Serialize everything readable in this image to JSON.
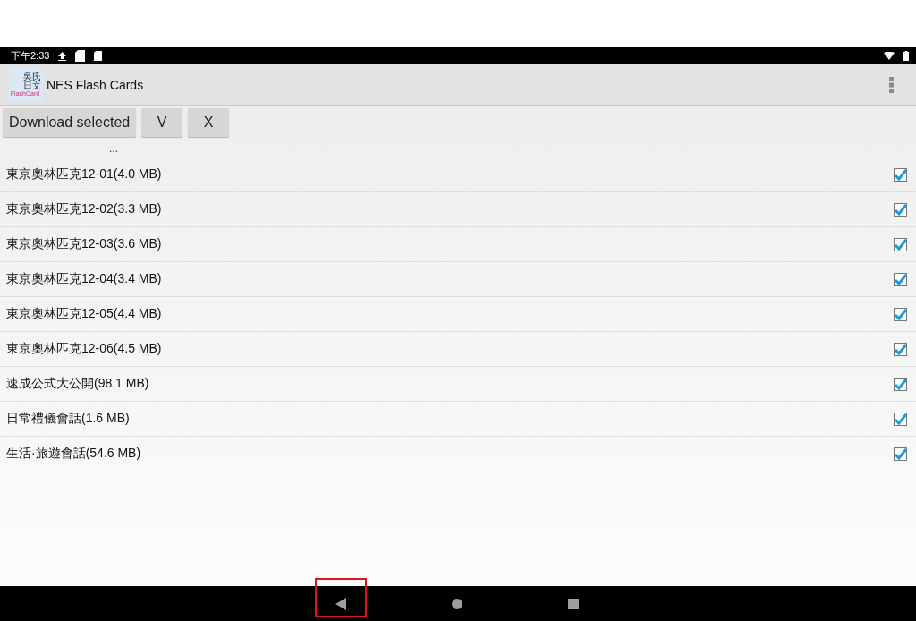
{
  "status_bar": {
    "time": "下午2:33"
  },
  "app_bar": {
    "icon_lines": [
      "吳氏",
      "日文"
    ],
    "icon_caption": "FlashCard",
    "title": "NES Flash Cards"
  },
  "toolbar": {
    "buttons": [
      "Download selected",
      "V",
      "X"
    ]
  },
  "parent_entry": "...",
  "files": [
    {
      "label": "東京奧林匹克12-01(4.0 MB)",
      "checked": true
    },
    {
      "label": "東京奧林匹克12-02(3.3 MB)",
      "checked": true
    },
    {
      "label": "東京奧林匹克12-03(3.6 MB)",
      "checked": true
    },
    {
      "label": "東京奧林匹克12-04(3.4 MB)",
      "checked": true
    },
    {
      "label": "東京奧林匹克12-05(4.4 MB)",
      "checked": true
    },
    {
      "label": "東京奧林匹克12-06(4.5 MB)",
      "checked": true
    },
    {
      "label": "速成公式大公開(98.1 MB)",
      "checked": true
    },
    {
      "label": "日常禮儀會話(1.6 MB)",
      "checked": true
    },
    {
      "label": "生活·旅遊會話(54.6 MB)",
      "checked": true
    }
  ],
  "nav_bar": [
    {
      "kind": "back",
      "highlighted": true
    },
    {
      "kind": "home",
      "highlighted": false
    },
    {
      "kind": "recents",
      "highlighted": false
    }
  ]
}
